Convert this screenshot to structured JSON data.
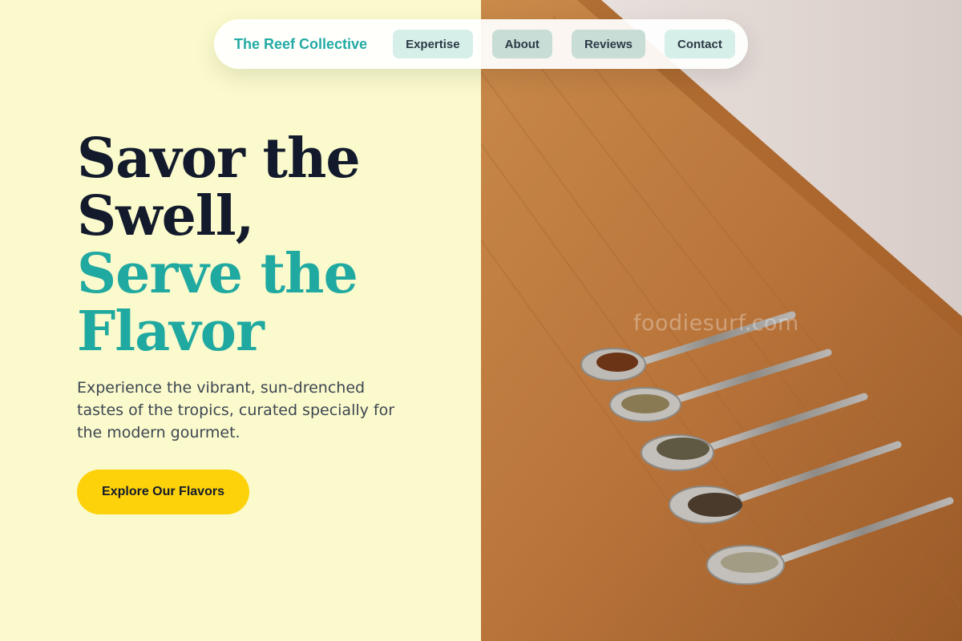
{
  "nav": {
    "brand": "The Reef Collective",
    "links": [
      "Expertise",
      "About",
      "Reviews",
      "Contact"
    ]
  },
  "hero": {
    "headline_line1": "Savor the",
    "headline_line2": "Swell,",
    "headline_line3": "Serve the",
    "headline_line4": "Flavor",
    "subtitle": "Experience the vibrant, sun-drenched tastes of the tropics, curated specially for the modern gourmet.",
    "cta_label": "Explore Our Flavors"
  },
  "image": {
    "watermark": "foodiesurf.com"
  },
  "colors": {
    "background": "#fafacc",
    "brand_teal": "#20a9a1",
    "headline_dark": "#121a2c",
    "cta_yellow": "#fdd20a"
  }
}
